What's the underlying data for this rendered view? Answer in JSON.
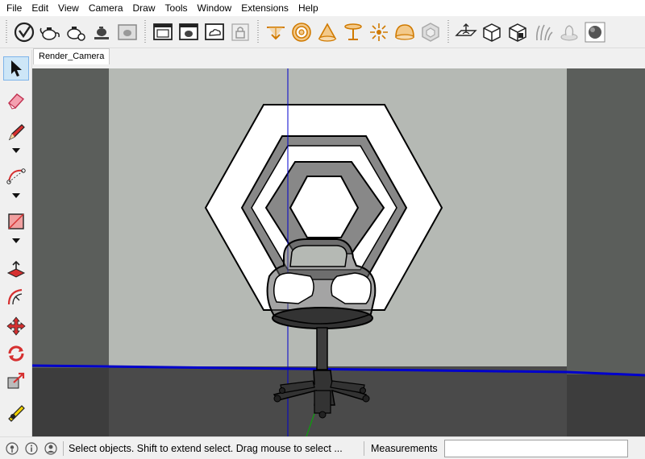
{
  "menu": [
    "File",
    "Edit",
    "View",
    "Camera",
    "Draw",
    "Tools",
    "Window",
    "Extensions",
    "Help"
  ],
  "toolbar": {
    "groups": [
      [
        "sketchup-logo-icon",
        "teapot-icon",
        "teapot-settings-icon",
        "teapot-cup-icon",
        "teapot-frame-icon"
      ],
      [
        "window-frame-icon",
        "window-teapot-icon",
        "window-cloud-icon",
        "lock-icon"
      ],
      [
        "push-down-icon",
        "rings-icon",
        "cone-icon",
        "table-icon",
        "sun-burst-icon",
        "dome-icon",
        "hex-box-icon"
      ],
      [
        "plane-icon",
        "box-icon",
        "box-cut-icon",
        "grass-icon",
        "shrub-icon",
        "sphere-icon"
      ]
    ]
  },
  "palette": {
    "tools": [
      "select-arrow-icon",
      "eraser-icon",
      "pencil-icon",
      "arc-icon",
      "rectangle-icon",
      "push-pull-icon",
      "offset-icon",
      "move-icon",
      "rotate-icon",
      "scale-icon",
      "tape-measure-icon"
    ]
  },
  "scene_tab": {
    "label": "Render_Camera"
  },
  "status": {
    "text": "Select objects. Shift to extend select. Drag mouse to select ...",
    "measurements_label": "Measurements",
    "measurements_value": ""
  },
  "colors": {
    "wall": "#b5b9b4",
    "side_wall": "#5b5e5b",
    "floor": "#4a4a4a",
    "blue_axis": "#0000cc",
    "green_axis": "#00b000",
    "selected_tool": "#cde6f7"
  }
}
